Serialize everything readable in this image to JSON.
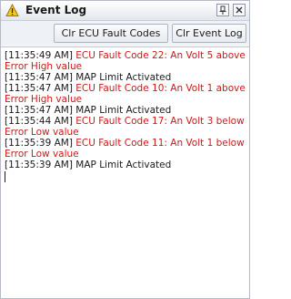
{
  "window": {
    "title": "Event Log",
    "icon": "warning-triangle-icon",
    "pin_icon": "pin-icon",
    "close_icon": "close-icon"
  },
  "toolbar": {
    "clear_fault_codes_label": "Clr ECU Fault Codes",
    "clear_event_log_label": "Clr Event Log"
  },
  "colors": {
    "fault_text": "#cc1a1a",
    "normal_text": "#1a1a1a"
  },
  "log": {
    "entries": [
      {
        "timestamp": "[11:35:49 AM]",
        "message": "ECU Fault Code 22: An Volt 5 above Error High value",
        "type": "fault"
      },
      {
        "timestamp": "[11:35:47 AM]",
        "message": "MAP Limit Activated",
        "type": "normal"
      },
      {
        "timestamp": "[11:35:47 AM]",
        "message": "ECU Fault Code 10: An Volt 1 above Error High value",
        "type": "fault"
      },
      {
        "timestamp": "[11:35:47 AM]",
        "message": "MAP Limit Activated",
        "type": "normal"
      },
      {
        "timestamp": "[11:35:44 AM]",
        "message": "ECU Fault Code 17: An Volt 3 below Error Low value",
        "type": "fault"
      },
      {
        "timestamp": "[11:35:39 AM]",
        "message": "ECU Fault Code 11: An Volt 1 below Error Low value",
        "type": "fault"
      },
      {
        "timestamp": "[11:35:39 AM]",
        "message": "MAP Limit Activated",
        "type": "normal"
      }
    ]
  }
}
